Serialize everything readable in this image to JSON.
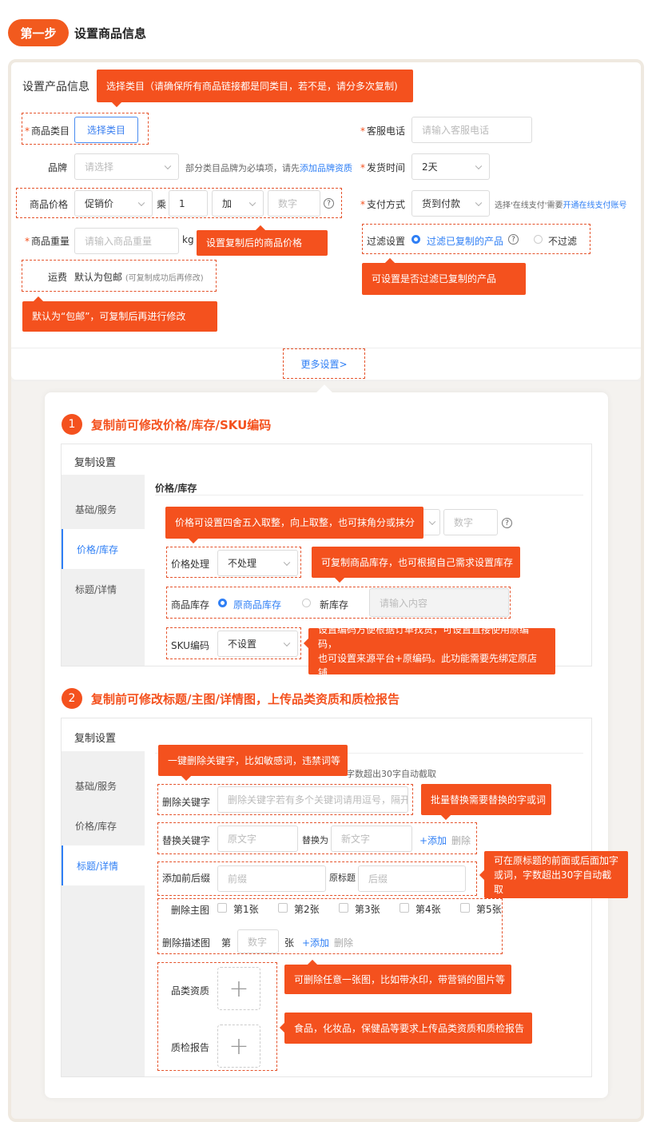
{
  "header": {
    "step": "第一步",
    "title": "设置商品信息"
  },
  "product": {
    "section_title": "设置产品信息",
    "category": {
      "label": "商品类目",
      "button": "选择类目"
    },
    "service_phone": {
      "label": "客服电话",
      "placeholder": "请输入客服电话"
    },
    "brand": {
      "label": "品牌",
      "placeholder": "请选择",
      "hint": "部分类目品牌为必填项，请先",
      "hint_link": "添加品牌资质"
    },
    "ship_time": {
      "label": "发货时间",
      "value": "2天"
    },
    "price": {
      "label": "商品价格",
      "type": "促销价",
      "mult": "乘",
      "factor": "1",
      "op": "加",
      "num_placeholder": "数字",
      "help": "?"
    },
    "payment": {
      "label": "支付方式",
      "value": "货到付款",
      "hint": "选择'在线支付'需要",
      "hint_link": "开通在线支付账号"
    },
    "weight": {
      "label": "商品重量",
      "placeholder": "请输入商品重量",
      "unit": "kg"
    },
    "filter": {
      "label": "过滤设置",
      "opt1": "过滤已复制的产品",
      "help": "?",
      "opt2": "不过滤"
    },
    "shipping": {
      "label": "运费",
      "value": "默认为包邮",
      "note": "(可复制成功后再修改)"
    },
    "more": "更多设置>"
  },
  "tips": {
    "category": "选择类目（请确保所有商品链接都是同类目，若不是，请分多次复制)",
    "price": "设置复制后的商品价格",
    "filter": "可设置是否过滤已复制的产品",
    "shipping": "默认为“包邮”，可复制后再进行修改",
    "rounding": "价格可设置四舍五入取整，向上取整，也可抹角分或抹分",
    "stock": "可复制商品库存，也可根据自己需求设置库存",
    "sku_line1": "设置编码方便根据订单找货，可设置直接使用原编码，",
    "sku_line2": "也可设置来源平台+原编码。此功能需要先绑定原店铺",
    "delete_kw": "一键删除关键字，比如敏感词，违禁词等",
    "replace_kw": "批量替换需要替换的字或词",
    "prefix_line1": "可在原标题的前面或后面加字",
    "prefix_line2": "或词，字数超出30字自动截取",
    "delete_img": "可删除任意一张图，比如带水印，带营销的图片等",
    "upload": "食品，化妆品，保健品等要求上传品类资质和质检报告"
  },
  "sec1": {
    "num": "1",
    "title": "复制前可修改价格/库存/SKU编码",
    "panel_title": "复制设置",
    "sidebar": [
      "基础/服务",
      "价格/库存",
      "标题/详情"
    ],
    "group": "价格/库存",
    "num_placeholder": "数字",
    "help": "?",
    "price_proc": {
      "label": "价格处理",
      "value": "不处理"
    },
    "stock": {
      "label": "商品库存",
      "opt1": "原商品库存",
      "opt2": "新库存",
      "placeholder": "请输入内容"
    },
    "sku": {
      "label": "SKU编码",
      "value": "不设置"
    }
  },
  "sec2": {
    "num": "2",
    "title": "复制前可修改标题/主图/详情图，上传品类资质和质检报告",
    "panel_title": "复制设置",
    "sidebar": [
      "基础/服务",
      "价格/库存",
      "标题/详情"
    ],
    "partial_hint": "字数超出30字自动截取",
    "delete_kw": {
      "label": "删除关键字",
      "placeholder": "删除关键字若有多个关键词请用逗号，隔开"
    },
    "replace_kw": {
      "label": "替换关键字",
      "ph1": "原文字",
      "mid": "替换为",
      "ph2": "新文字",
      "add": "+添加",
      "del": "删除"
    },
    "prefix": {
      "label": "添加前后缀",
      "ph1": "前缀",
      "mid": "原标题",
      "ph2": "后缀"
    },
    "main_img": {
      "label": "删除主图",
      "opts": [
        "第1张",
        "第2张",
        "第3张",
        "第4张",
        "第5张"
      ]
    },
    "desc_img": {
      "label": "删除描述图",
      "pre": "第",
      "placeholder": "数字",
      "post": "张",
      "add": "+添加",
      "del": "删除"
    },
    "qual": {
      "label": "品类资质"
    },
    "report": {
      "label": "质检报告"
    }
  }
}
